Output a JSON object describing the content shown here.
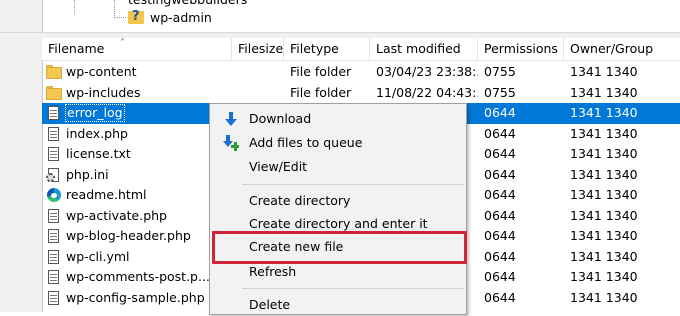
{
  "tree": {
    "items": [
      {
        "label": "testingwebbuilders"
      },
      {
        "label": "wp-admin"
      }
    ]
  },
  "columns": [
    "Filename",
    "Filesize",
    "Filetype",
    "Last modified",
    "Permissions",
    "Owner/Group"
  ],
  "files": [
    {
      "name": "wp-content",
      "icon": "folder-icon",
      "size": "",
      "type": "File folder",
      "modified": "03/04/23 23:38:...",
      "perm": "0755",
      "owner": "1341 1340",
      "selected": false
    },
    {
      "name": "wp-includes",
      "icon": "folder-icon",
      "size": "",
      "type": "File folder",
      "modified": "11/08/22 04:43:...",
      "perm": "0755",
      "owner": "1341 1340",
      "selected": false
    },
    {
      "name": "error_log",
      "icon": "document-icon",
      "size": "",
      "type": "",
      "modified": "",
      "perm": "0644",
      "owner": "1341 1340",
      "selected": true
    },
    {
      "name": "index.php",
      "icon": "document-icon",
      "size": "",
      "type": "",
      "modified": "",
      "perm": "0644",
      "owner": "1341 1340",
      "selected": false
    },
    {
      "name": "license.txt",
      "icon": "document-icon",
      "size": "",
      "type": "",
      "modified": "",
      "perm": "0644",
      "owner": "1341 1340",
      "selected": false
    },
    {
      "name": "php.ini",
      "icon": "settings-file-icon",
      "size": "",
      "type": "",
      "modified": "",
      "perm": "0644",
      "owner": "1341 1340",
      "selected": false
    },
    {
      "name": "readme.html",
      "icon": "edge-browser-icon",
      "size": "",
      "type": "",
      "modified": "",
      "perm": "0644",
      "owner": "1341 1340",
      "selected": false
    },
    {
      "name": "wp-activate.php",
      "icon": "document-icon",
      "size": "",
      "type": "",
      "modified": "",
      "perm": "0644",
      "owner": "1341 1340",
      "selected": false
    },
    {
      "name": "wp-blog-header.php",
      "icon": "document-icon",
      "size": "",
      "type": "",
      "modified": "",
      "perm": "0644",
      "owner": "1341 1340",
      "selected": false
    },
    {
      "name": "wp-cli.yml",
      "icon": "document-icon",
      "size": "",
      "type": "",
      "modified": "",
      "perm": "0644",
      "owner": "1341 1340",
      "selected": false
    },
    {
      "name": "wp-comments-post.p...",
      "icon": "document-icon",
      "size": "",
      "type": "",
      "modified": "",
      "perm": "0644",
      "owner": "1341 1340",
      "selected": false
    },
    {
      "name": "wp-config-sample.php",
      "icon": "document-icon",
      "size": "",
      "type": "",
      "modified": "",
      "perm": "0644",
      "owner": "1341 1340",
      "selected": false
    }
  ],
  "context_menu": {
    "items": [
      {
        "label": "Download",
        "icon": "download-arrow-icon"
      },
      {
        "label": "Add files to queue",
        "icon": "add-to-queue-icon"
      },
      {
        "label": "View/Edit",
        "icon": ""
      },
      {
        "separator": true
      },
      {
        "label": "Create directory",
        "icon": ""
      },
      {
        "label": "Create directory and enter it",
        "icon": ""
      },
      {
        "label": "Create new file",
        "icon": "",
        "highlighted": true
      },
      {
        "label": "Refresh",
        "icon": ""
      },
      {
        "separator": true
      },
      {
        "label": "Delete",
        "icon": ""
      }
    ]
  },
  "colors": {
    "selection": "#0078d7",
    "highlight_border": "#d0243a"
  }
}
